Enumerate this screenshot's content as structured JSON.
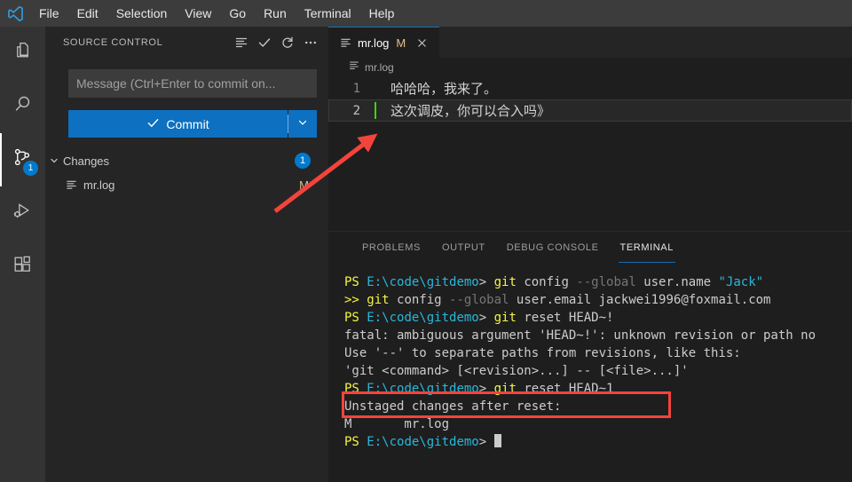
{
  "menubar": {
    "logo_name": "vscode-logo",
    "items": [
      {
        "label": "File"
      },
      {
        "label": "Edit"
      },
      {
        "label": "Selection"
      },
      {
        "label": "View"
      },
      {
        "label": "Go"
      },
      {
        "label": "Run"
      },
      {
        "label": "Terminal"
      },
      {
        "label": "Help"
      }
    ]
  },
  "activitybar": {
    "items": [
      {
        "name": "explorer",
        "icon": "files-icon",
        "badge": ""
      },
      {
        "name": "search",
        "icon": "search-icon",
        "badge": ""
      },
      {
        "name": "source-control",
        "icon": "source-control-icon",
        "badge": "1"
      },
      {
        "name": "run-and-debug",
        "icon": "run-debug-icon",
        "badge": ""
      },
      {
        "name": "extensions",
        "icon": "extensions-icon",
        "badge": ""
      }
    ]
  },
  "sidebar": {
    "title": "SOURCE CONTROL",
    "actions": [
      {
        "name": "view-as-list-icon",
        "label": "View as List"
      },
      {
        "name": "check-icon",
        "label": "Commit"
      },
      {
        "name": "refresh-icon",
        "label": "Refresh"
      },
      {
        "name": "more-actions-icon",
        "label": "Views and More Actions"
      }
    ],
    "commit_message": {
      "value": "",
      "placeholder": "Message (Ctrl+Enter to commit on..."
    },
    "commit_button": {
      "label": "Commit",
      "check_icon": "check-icon",
      "dropdown_icon": "chevron-down-icon"
    },
    "changes_group": {
      "chevron_icon": "chevron-down-icon",
      "label": "Changes",
      "count": "1"
    },
    "files": [
      {
        "icon": "file-log-icon",
        "name": "mr.log",
        "status": "M"
      }
    ]
  },
  "editor": {
    "tabs": [
      {
        "icon": "file-log-icon",
        "label": "mr.log",
        "dirty": "M",
        "close_icon": "close-icon",
        "active": true
      }
    ],
    "breadcrumb": {
      "icon": "file-log-icon",
      "label": "mr.log"
    },
    "lines": [
      {
        "number": "1",
        "text": "哈哈哈，我来了。",
        "active": false
      },
      {
        "number": "2",
        "text": "这次调皮，你可以合入吗》",
        "active": true
      }
    ]
  },
  "panel": {
    "tabs": [
      {
        "label": "PROBLEMS",
        "active": false
      },
      {
        "label": "OUTPUT",
        "active": false
      },
      {
        "label": "DEBUG CONSOLE",
        "active": false
      },
      {
        "label": "TERMINAL",
        "active": true
      }
    ],
    "terminal_lines": [
      {
        "segments": [
          {
            "text": "PS ",
            "color": "c-yellow"
          },
          {
            "text": "E:\\code\\gitdemo",
            "color": "c-cyan"
          },
          {
            "text": "> ",
            "color": "c-white"
          },
          {
            "text": "git",
            "color": "c-yellow"
          },
          {
            "text": " config ",
            "color": "c-white"
          },
          {
            "text": "--global",
            "color": "c-grey"
          },
          {
            "text": " user.name ",
            "color": "c-white"
          },
          {
            "text": "\"Jack\"",
            "color": "c-cyan"
          }
        ]
      },
      {
        "segments": [
          {
            "text": ">> ",
            "color": "c-yellow"
          },
          {
            "text": "git",
            "color": "c-yellow"
          },
          {
            "text": " config ",
            "color": "c-white"
          },
          {
            "text": "--global",
            "color": "c-grey"
          },
          {
            "text": " user.email jackwei1996@foxmail.com",
            "color": "c-white"
          }
        ]
      },
      {
        "segments": [
          {
            "text": "PS ",
            "color": "c-yellow"
          },
          {
            "text": "E:\\code\\gitdemo",
            "color": "c-cyan"
          },
          {
            "text": "> ",
            "color": "c-white"
          },
          {
            "text": "git",
            "color": "c-yellow"
          },
          {
            "text": " reset HEAD~!",
            "color": "c-white"
          }
        ]
      },
      {
        "segments": [
          {
            "text": "fatal: ambiguous argument 'HEAD~!': unknown revision or path no",
            "color": "c-white"
          }
        ]
      },
      {
        "segments": [
          {
            "text": "Use '--' to separate paths from revisions, like this:",
            "color": "c-white"
          }
        ]
      },
      {
        "segments": [
          {
            "text": "'git <command> [<revision>...] -- [<file>...]'",
            "color": "c-white"
          }
        ]
      },
      {
        "segments": [
          {
            "text": "PS ",
            "color": "c-yellow"
          },
          {
            "text": "E:\\code\\gitdemo",
            "color": "c-cyan"
          },
          {
            "text": "> ",
            "color": "c-white"
          },
          {
            "text": "git",
            "color": "c-yellow"
          },
          {
            "text": " reset HEAD~1",
            "color": "c-white"
          }
        ]
      },
      {
        "segments": [
          {
            "text": "Unstaged changes after reset:",
            "color": "c-white"
          }
        ]
      },
      {
        "segments": [
          {
            "text": "M       mr.log",
            "color": "c-white"
          }
        ]
      },
      {
        "segments": [
          {
            "text": "PS ",
            "color": "c-yellow"
          },
          {
            "text": "E:\\code\\gitdemo",
            "color": "c-cyan"
          },
          {
            "text": "> ",
            "color": "c-white"
          }
        ],
        "cursor": true
      }
    ]
  },
  "annotations": {
    "arrow": {
      "name": "red-arrow-annotation",
      "color": "#f4433c"
    },
    "highlight_box": {
      "name": "red-highlight-box-annotation",
      "color": "#f4433c"
    }
  },
  "colors": {
    "accent": "#007acc",
    "commit_button": "#0e70c0",
    "annotation_red": "#f4433c",
    "modified_badge": "#e2c08d",
    "cursor_green": "#3ad900"
  }
}
